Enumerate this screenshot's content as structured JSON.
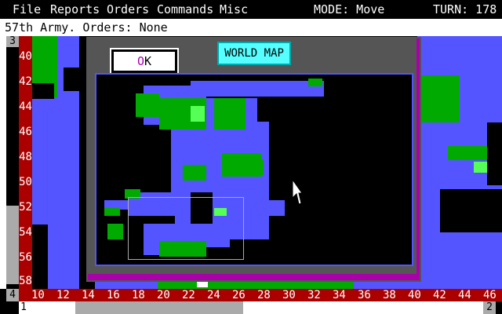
{
  "menu": {
    "items": [
      "File",
      "Reports",
      "Orders",
      "Commands",
      "Misc"
    ],
    "mode": "MODE: Move",
    "turn": "TURN: 178"
  },
  "status_line": "57th Army. Orders: None",
  "corners": {
    "top_left": "3",
    "bottom_left": "4",
    "bottom_left_2": "1",
    "bottom_right": "2"
  },
  "row_labels": [
    "40",
    "42",
    "44",
    "46",
    "48",
    "50",
    "52",
    "54",
    "56",
    "58"
  ],
  "col_labels": [
    "10",
    "12",
    "14",
    "16",
    "18",
    "20",
    "22",
    "24",
    "26",
    "28",
    "30",
    "32",
    "34",
    "36",
    "38",
    "40",
    "42",
    "44",
    "46"
  ],
  "dialog": {
    "title": "WORLD MAP",
    "ok_first": "O",
    "ok_rest": "K"
  },
  "colors": {
    "sea": "#5555ff",
    "land": "#00aa00",
    "light_land": "#55ff55",
    "label_bar": "#aa0000",
    "dialog_frame": "#aa00aa",
    "dialog_bg": "#555555",
    "title_button": "#55ffff"
  },
  "icons": [
    "arrow-cursor-icon"
  ]
}
